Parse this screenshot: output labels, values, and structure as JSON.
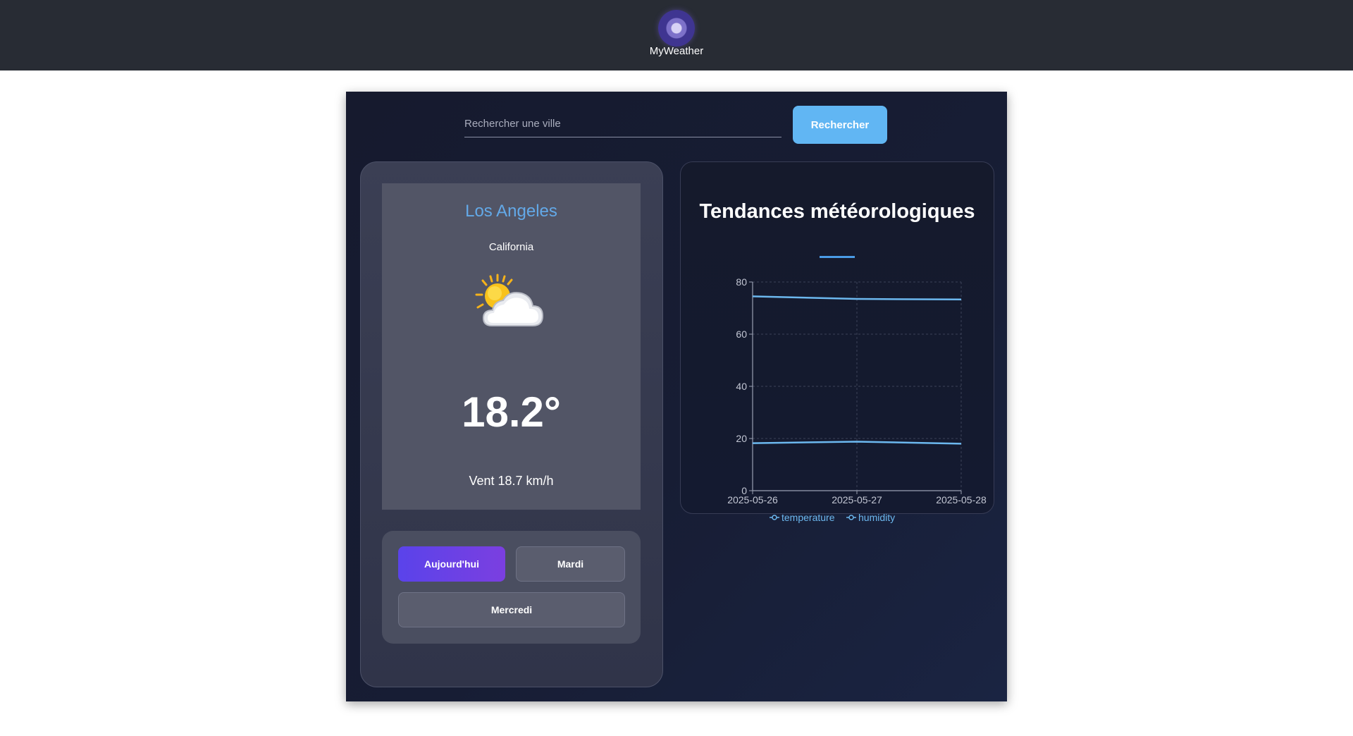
{
  "header": {
    "app_name": "MyWeather",
    "logo_icon": "moon-logo-icon"
  },
  "search": {
    "placeholder": "Rechercher une ville",
    "value": "",
    "button_label": "Rechercher"
  },
  "current": {
    "city": "Los Angeles",
    "region": "California",
    "condition_icon": "sun-behind-cloud-icon",
    "temperature": "18.2°",
    "wind": "Vent 18.7 km/h"
  },
  "days": [
    {
      "label": "Aujourd'hui",
      "active": true
    },
    {
      "label": "Mardi",
      "active": false
    },
    {
      "label": "Mercredi",
      "active": false
    }
  ],
  "colors": {
    "accent": "#61b6f3",
    "city": "#63a9e8",
    "active_day": "#5a43ea",
    "series": "#6cb8ef"
  },
  "chart_data": {
    "type": "line",
    "title": "Tendances météorologiques",
    "x": [
      "2025-05-26",
      "2025-05-27",
      "2025-05-28"
    ],
    "ylim": [
      0,
      80
    ],
    "yticks": [
      0,
      20,
      40,
      60,
      80
    ],
    "grid": true,
    "legend_position": "bottom",
    "series": [
      {
        "name": "temperature",
        "values": [
          74.5,
          73.5,
          73.3
        ]
      },
      {
        "name": "humidity",
        "values": [
          18.2,
          18.8,
          18.0
        ]
      }
    ]
  }
}
